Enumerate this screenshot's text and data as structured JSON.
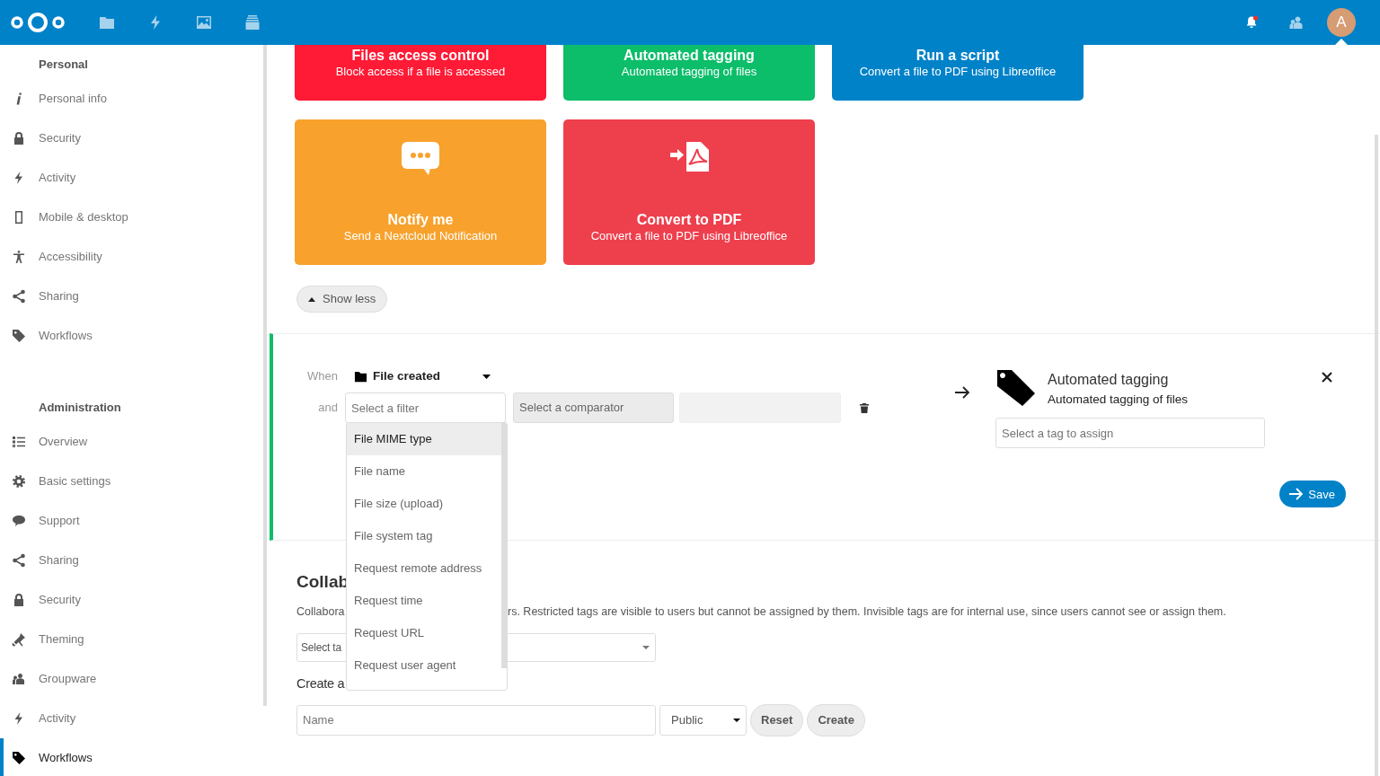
{
  "header": {
    "apps": [
      {
        "kind": "files"
      },
      {
        "kind": "activity"
      },
      {
        "kind": "photos"
      },
      {
        "kind": "deck"
      }
    ],
    "notifications_unread": true,
    "avatar": "A"
  },
  "sidebar": {
    "sections": [
      {
        "heading": "Personal",
        "items": [
          {
            "label": "Personal info",
            "kind": "info",
            "selected": false
          },
          {
            "label": "Security",
            "kind": "lock",
            "selected": false
          },
          {
            "label": "Activity",
            "kind": "bolt",
            "selected": false
          },
          {
            "label": "Mobile & desktop",
            "kind": "phone",
            "selected": false
          },
          {
            "label": "Accessibility",
            "kind": "person",
            "selected": false
          },
          {
            "label": "Sharing",
            "kind": "share",
            "selected": false
          },
          {
            "label": "Workflows",
            "kind": "tag",
            "selected": false
          }
        ]
      },
      {
        "heading": "Administration",
        "items": [
          {
            "label": "Overview",
            "kind": "list",
            "selected": false
          },
          {
            "label": "Basic settings",
            "kind": "gear",
            "selected": false
          },
          {
            "label": "Support",
            "kind": "chat",
            "selected": false
          },
          {
            "label": "Sharing",
            "kind": "share",
            "selected": false
          },
          {
            "label": "Security",
            "kind": "lock",
            "selected": false
          },
          {
            "label": "Theming",
            "kind": "brush",
            "selected": false
          },
          {
            "label": "Groupware",
            "kind": "group",
            "selected": false
          },
          {
            "label": "Activity",
            "kind": "bolt",
            "selected": false
          },
          {
            "label": "Workflows",
            "kind": "tag",
            "selected": true
          }
        ]
      }
    ]
  },
  "cards": [
    {
      "title": "Files access control",
      "description": "Block access if a file is accessed",
      "color": "#ff1a35"
    },
    {
      "title": "Automated tagging",
      "description": "Automated tagging of files",
      "color": "#0cbd6a"
    },
    {
      "title": "Run a script",
      "description": "Convert a file to PDF using Libreoffice",
      "color": "#0082c9"
    },
    {
      "title": "Notify me",
      "description": "Send a Nextcloud Notification",
      "color": "#f8a22d",
      "kind": "chat"
    },
    {
      "title": "Convert to PDF",
      "description": "Convert a file to PDF using Libreoffice",
      "color": "#ee3f4d",
      "kind": "pdf"
    }
  ],
  "show_less_button": "Show less",
  "rule": {
    "when_label": "When",
    "event": "File created",
    "and_label": "and",
    "filter": {
      "placeholder": "Select a filter"
    },
    "comparator": {
      "placeholder": "Select a comparator",
      "disabled": true
    },
    "value_field": {
      "disabled": true
    },
    "filter_options": [
      {
        "label": "File MIME type",
        "selected": true
      },
      {
        "label": "File name",
        "selected": false
      },
      {
        "label": "File size (upload)",
        "selected": false
      },
      {
        "label": "File system tag",
        "selected": false
      },
      {
        "label": "Request remote address",
        "selected": false
      },
      {
        "label": "Request time",
        "selected": false
      },
      {
        "label": "Request URL",
        "selected": false
      },
      {
        "label": "Request user agent",
        "selected": false
      }
    ],
    "operation": {
      "title": "Automated tagging",
      "description": "Automated tagging of files",
      "tag_field": {
        "placeholder": "Select a tag to assign"
      }
    },
    "save_button": "Save"
  },
  "collaborative_tags": {
    "heading": "Collab",
    "description_parts": [
      "Collabora",
      "rs. Restricted tags are visible to users but cannot be assigned by them. Invisible tags are for internal use, since users cannot see or assign them."
    ],
    "tag_select": "Select ta",
    "create_heading": "Create a",
    "name_field": {
      "placeholder": "Name"
    },
    "visibility": "Public",
    "reset_button": "Reset",
    "create_button": "Create"
  }
}
